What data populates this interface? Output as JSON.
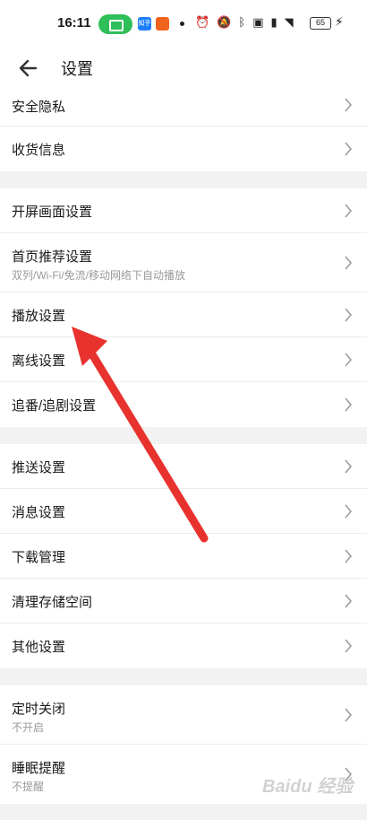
{
  "status_bar": {
    "time": "16:11",
    "app1": "知乎",
    "icons": [
      "alarm-icon",
      "mute-icon",
      "bluetooth-icon",
      "hd-icon",
      "signal-icon",
      "wifi-icon"
    ],
    "battery": "65"
  },
  "header": {
    "title": "设置"
  },
  "sections": [
    {
      "items": [
        {
          "label": "安全隐私"
        },
        {
          "label": "收货信息"
        }
      ]
    },
    {
      "items": [
        {
          "label": "开屏画面设置"
        },
        {
          "label": "首页推荐设置",
          "sub": "双列/Wi-Fi/免流/移动网络下自动播放"
        },
        {
          "label": "播放设置"
        },
        {
          "label": "离线设置"
        },
        {
          "label": "追番/追剧设置"
        }
      ]
    },
    {
      "items": [
        {
          "label": "推送设置"
        },
        {
          "label": "消息设置"
        },
        {
          "label": "下载管理"
        },
        {
          "label": "清理存储空间"
        },
        {
          "label": "其他设置"
        }
      ]
    },
    {
      "items": [
        {
          "label": "定时关闭",
          "sub": "不开启"
        },
        {
          "label": "睡眠提醒",
          "sub": "不提醒"
        }
      ]
    }
  ],
  "annotation": {
    "arrow_color": "#e8322e"
  },
  "watermark": "Baidu 经验"
}
